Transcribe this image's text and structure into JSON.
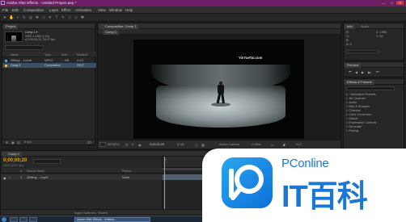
{
  "window": {
    "title": "Adobe After Effects - Untitled Project.aep *",
    "controls": [
      "—",
      "□",
      "✕"
    ]
  },
  "menu": [
    "File",
    "Edit",
    "Composition",
    "Layer",
    "Effect",
    "Animation",
    "View",
    "Window",
    "Help"
  ],
  "project_panel": {
    "tab": "Project",
    "comp_name": "Comp 1 ▾",
    "comp_info_1": "1920 x 1080 (1.00)",
    "comp_info_2": "Δ 0;00;00;20, 29.97 fps",
    "columns": [
      "Name",
      "Type",
      "Size",
      "Media D"
    ],
    "items": [
      {
        "name": "3Wieuy ...Luxurt",
        "type": "MPEG",
        "size": "... MB",
        "dur": "Δ 0;0",
        "color": "#6a9bd1"
      },
      {
        "name": "Comp 1",
        "type": "Composition",
        "size": "",
        "dur": "29.97",
        "color": "#d9b96c"
      }
    ],
    "bottom_label": "8 bpc"
  },
  "viewer": {
    "tab": "Composition: Comp 1",
    "subtab": "Comp 1",
    "watermark": "YinYueTai.com",
    "footer": {
      "zoom": "50%(Pv)",
      "timecode": "0;00;00;28",
      "resolution": "(Full)",
      "camera": "Active Camera",
      "views": "1 View",
      "offset": "+0.0"
    }
  },
  "info_panel": {
    "tabs": [
      "Info",
      "Audio"
    ],
    "rows": [
      "R:",
      "G:",
      "B:",
      "A: 0"
    ],
    "xy": [
      "X: 1996",
      "Y: 52"
    ]
  },
  "preview_panel": {
    "tab": "Preview"
  },
  "effects_panel": {
    "tab": "Effects & Presets",
    "items": [
      "* Animation Presets",
      "3D Channel",
      "Audio",
      "Blur & Sharpen",
      "Channel",
      "Color Correction",
      "Distort",
      "Expression Controls",
      "Generate",
      "Keying"
    ]
  },
  "timeline": {
    "tab": "Comp 1",
    "timecode": "0;00;00;20",
    "fps": "00020 (29.97 fps)",
    "columns": [
      "#",
      "Source Name",
      "Parent"
    ],
    "layer": {
      "index": "1",
      "name": "3Wieuy ...Lmp4",
      "parent": "None"
    },
    "ruler": [
      "0f",
      "05f",
      "10f",
      "15f",
      "20f"
    ],
    "footer": "Toggle Switches / Modes"
  },
  "taskbar": {
    "task": "Adobe After Effects - Untitled..."
  },
  "badge": {
    "brand": "PConline",
    "title": "IT百科",
    "colors": {
      "brand_blue": "#1a78d4",
      "logo_gradient": [
        "#2aa6f0",
        "#0d6fd8"
      ]
    }
  }
}
